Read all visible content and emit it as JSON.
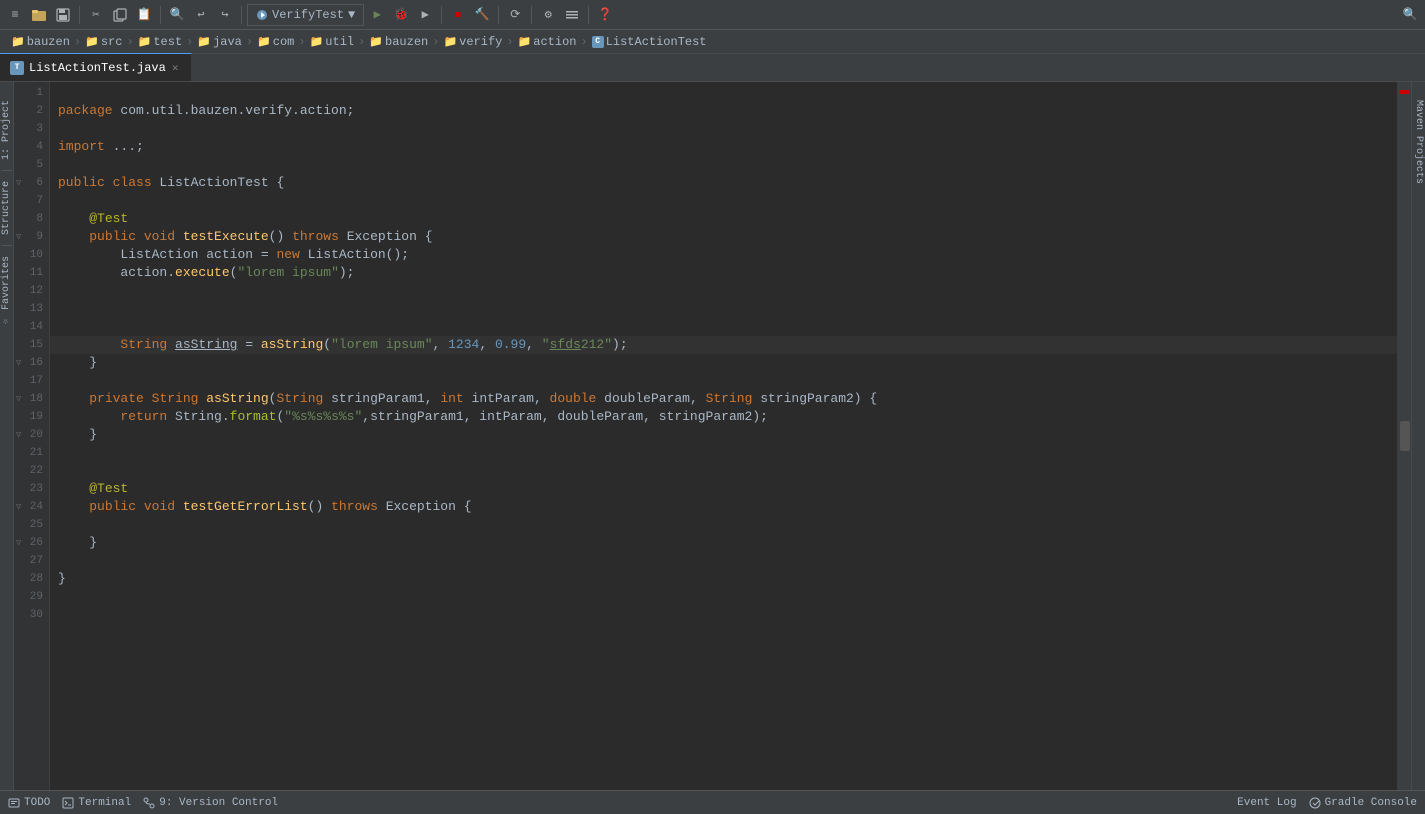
{
  "toolbar": {
    "run_config": "VerifyTest",
    "icons": [
      "☰",
      "📁",
      "💾",
      "✂",
      "📋",
      "📋",
      "🔍",
      "↩",
      "↪",
      "▶",
      "⏸",
      "⏹",
      "📍",
      "🔧",
      "⚙",
      "❓"
    ]
  },
  "breadcrumb": {
    "items": [
      {
        "label": "bauzen",
        "type": "folder"
      },
      {
        "label": "src",
        "type": "folder"
      },
      {
        "label": "test",
        "type": "folder"
      },
      {
        "label": "java",
        "type": "folder"
      },
      {
        "label": "com",
        "type": "folder"
      },
      {
        "label": "util",
        "type": "folder"
      },
      {
        "label": "bauzen",
        "type": "folder"
      },
      {
        "label": "verify",
        "type": "folder"
      },
      {
        "label": "action",
        "type": "folder"
      },
      {
        "label": "ListActionTest",
        "type": "class"
      }
    ]
  },
  "tab": {
    "label": "ListActionTest.java"
  },
  "code": {
    "lines": [
      "",
      "package com.util.bauzen.verify.action;",
      "",
      "import ...;",
      "",
      "public class ListActionTest {",
      "",
      "    @Test",
      "    public void testExecute() throws Exception {",
      "        ListAction action = new ListAction();",
      "        action.execute(\"lorem ipsum\");",
      "",
      "",
      "",
      "        String asString = asString(\"lorem ipsum\", 1234, 0.99, \"sfds212\");",
      "    }",
      "",
      "    private String asString(String stringParam1, int intParam, double doubleParam, String stringParam2) {",
      "        return String.format(\"%s%s%s%s\",stringParam1, intParam, doubleParam, stringParam2);",
      "    }",
      "",
      "",
      "    @Test",
      "    public void testGetErrorList() throws Exception {",
      "",
      "    }",
      "",
      "}"
    ]
  },
  "status_bar": {
    "todo": "TODO",
    "terminal": "Terminal",
    "version_control": "9: Version Control",
    "event_log": "Event Log",
    "gradle_console": "Gradle Console"
  },
  "side_panels": {
    "maven_projects": "Maven Projects",
    "structure": "Structure",
    "favorites": "Favorites"
  },
  "colors": {
    "background": "#2b2b2b",
    "gutter": "#313335",
    "toolbar": "#3c3f41",
    "accent": "#4a9eff",
    "keyword": "#cc7832",
    "string": "#6a8759",
    "number": "#6897bb",
    "method": "#ffc66d",
    "annotation": "#bbb529"
  }
}
